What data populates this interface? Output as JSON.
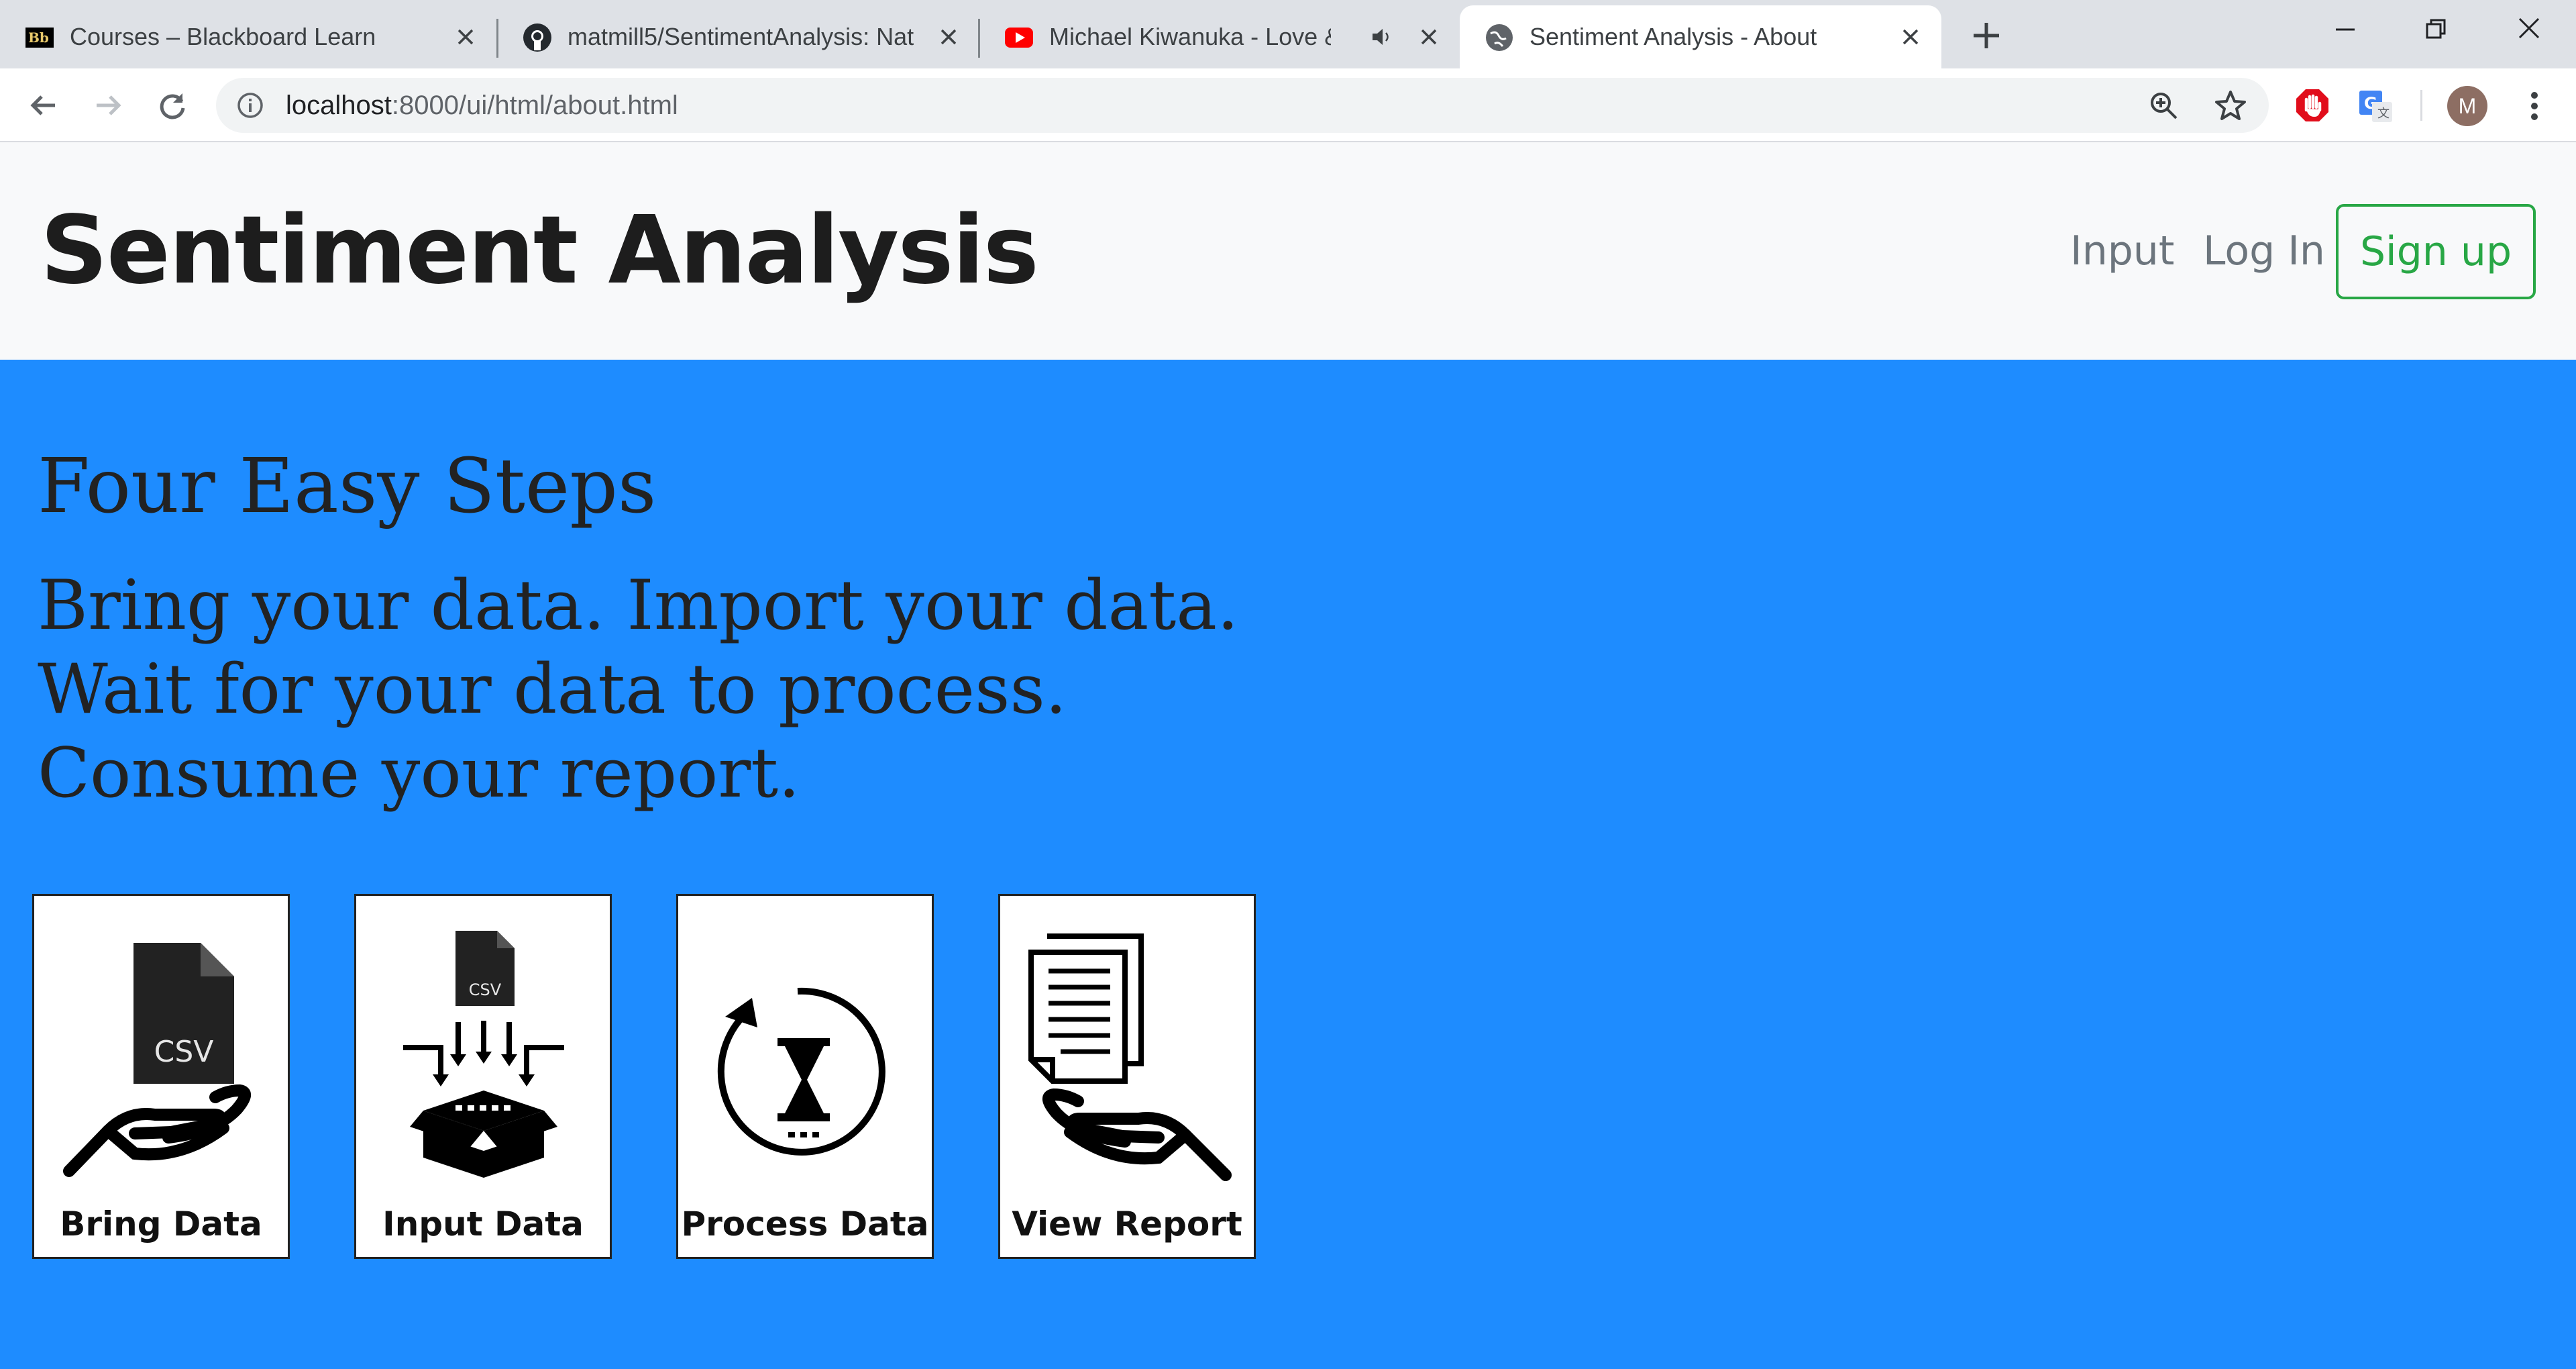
{
  "browser": {
    "tabs": [
      {
        "title": "Courses – Blackboard Learn",
        "favicon": "blackboard-icon",
        "active": false
      },
      {
        "title": "matmill5/SentimentAnalysis: Nat",
        "favicon": "github-icon",
        "active": false
      },
      {
        "title": "Michael Kiwanuka - Love & H",
        "favicon": "youtube-icon",
        "active": false,
        "audio": true
      },
      {
        "title": "Sentiment Analysis - About",
        "favicon": "globe-icon",
        "active": true
      }
    ],
    "url_host": "localhost",
    "url_path": ":8000/ui/html/about.html",
    "avatar_initial": "M"
  },
  "navbar": {
    "brand": "Sentiment Analysis",
    "links": [
      "Input",
      "Log In"
    ],
    "signup_label": "Sign up"
  },
  "hero": {
    "title": "Four Easy Steps",
    "lines": [
      "Bring your data. Import your data.",
      "Wait for your data to process.",
      "Consume your report."
    ]
  },
  "steps": [
    {
      "label": "Bring Data",
      "icon": "csv-hand-icon",
      "csv_text": "CSV"
    },
    {
      "label": "Input Data",
      "icon": "csv-box-icon",
      "csv_text": "CSV"
    },
    {
      "label": "Process Data",
      "icon": "hourglass-cycle-icon"
    },
    {
      "label": "View Report",
      "icon": "report-hand-icon"
    }
  ],
  "colors": {
    "page_bg": "#1e8cff",
    "navbar_bg": "#f8f9fa",
    "signup": "#28a745",
    "tabstrip": "#dee1e6"
  }
}
